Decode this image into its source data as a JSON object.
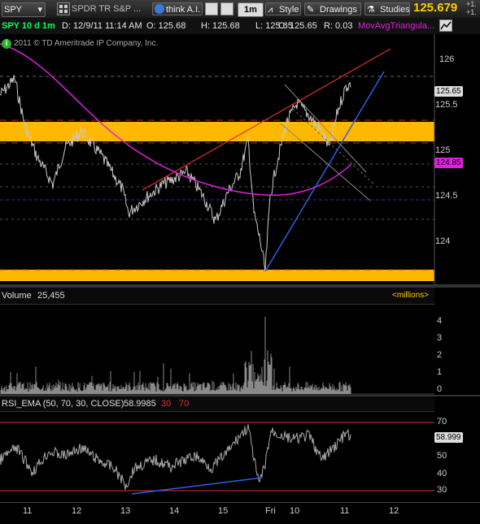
{
  "toolbar": {
    "symbol": "SPY",
    "description": "SPDR TR S&P ...",
    "think_ai": "think A.I.",
    "period": "1m",
    "style": "Style",
    "drawings": "Drawings",
    "studies": "Studies",
    "last_price": "125.679",
    "change_top": "+1.",
    "change_bottom": "+1."
  },
  "info": {
    "title": "SPY 10 d 1m",
    "date": "D: 12/9/11 11:14 AM",
    "open": "O: 125.68",
    "high": "H: 125.68",
    "low": "L: 125.65",
    "close": "C: 125.65",
    "range": "R: 0.03",
    "study": "MovAvgTriangula..."
  },
  "copyright": "2011 © TD Ameritrade IP Company, Inc.",
  "price_axis": {
    "ticks": [
      "126",
      "125.5",
      "125",
      "124.5",
      "124"
    ],
    "last_tag": "125.65",
    "ma_tag": "124.85"
  },
  "volume": {
    "label": "Volume",
    "value": "25,455",
    "unit_label": "<millions>",
    "ticks": [
      "4",
      "3",
      "2",
      "1",
      "0"
    ]
  },
  "rsi": {
    "label": "RSI_EMA (50, 70, 30, CLOSE)",
    "value": "58.9985",
    "low": "30",
    "high": "70",
    "ticks": [
      "70",
      "50",
      "40",
      "30"
    ],
    "last_tag": "58.999"
  },
  "time_axis": {
    "labels": [
      "11",
      "12",
      "13",
      "14",
      "15",
      "Fri",
      "10",
      "11",
      "12"
    ]
  },
  "colors": {
    "price_line": "#c8c8c8",
    "ma_line": "#e020e0",
    "trend_red": "#e03030",
    "trend_blue": "#3060e0",
    "zone": "#ffb800",
    "last_price": "#ffcc00"
  }
}
